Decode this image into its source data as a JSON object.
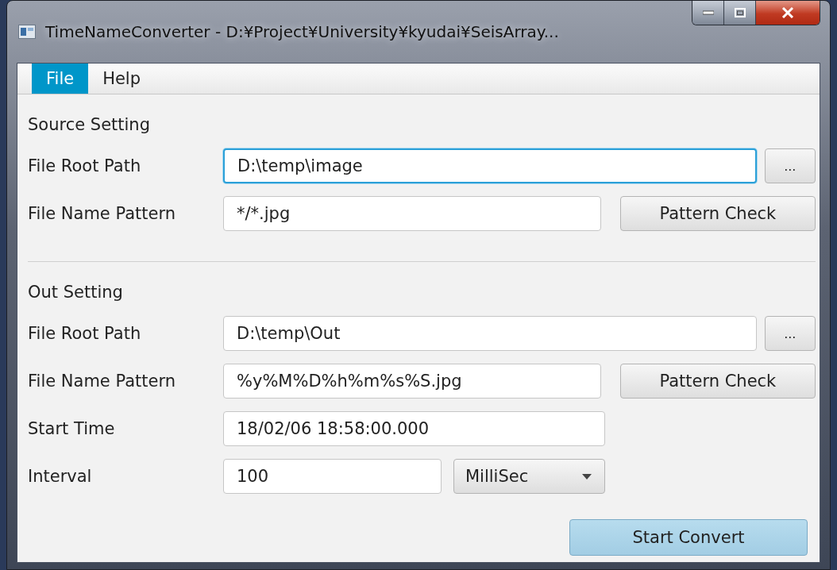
{
  "window": {
    "title": "TimeNameConverter - D:¥Project¥University¥kyudai¥SeisArray..."
  },
  "menu": [
    {
      "label": "File",
      "selected": true
    },
    {
      "label": "Help",
      "selected": false
    }
  ],
  "sections": [
    {
      "title": "Source Setting",
      "rows": [
        {
          "kind": "path",
          "label": "File Root Path",
          "value": "D:\\temp\\image",
          "focused": true,
          "button": "..."
        },
        {
          "kind": "pattern",
          "label": "File Name Pattern",
          "value": "*/*.jpg",
          "focused": false,
          "button": "Pattern Check"
        }
      ]
    },
    {
      "title": "Out Setting",
      "rows": [
        {
          "kind": "path",
          "label": "File Root Path",
          "value": "D:\\temp\\Out",
          "focused": false,
          "button": "..."
        },
        {
          "kind": "pattern",
          "label": "File Name Pattern",
          "value": "%y%M%D%h%m%s%S.jpg",
          "focused": false,
          "button": "Pattern Check"
        },
        {
          "kind": "text",
          "label": "Start Time",
          "value": "18/02/06 18:58:00.000",
          "focused": false
        },
        {
          "kind": "interval",
          "label": "Interval",
          "value": "100",
          "focused": false,
          "dropdown": "MilliSec"
        }
      ]
    }
  ],
  "action": {
    "label": "Start Convert"
  }
}
